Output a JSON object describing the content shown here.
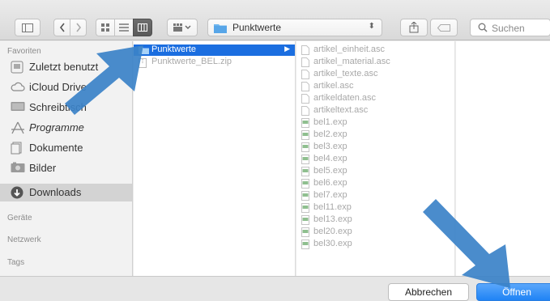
{
  "toolbar": {
    "sidebar_toggle_icon": "sidebar-toggle-icon",
    "back_icon": "chevron-left-icon",
    "forward_icon": "chevron-right-icon",
    "view_icons_icon": "icon-view-icon",
    "view_list_icon": "list-view-icon",
    "view_columns_icon": "column-view-icon",
    "view_gallery_icon": "gallery-view-icon",
    "path_label": "Punktwerte",
    "share_icon": "share-icon",
    "tag_icon": "tag-icon",
    "search_placeholder": "Suchen"
  },
  "sidebar": {
    "favorites_header": "Favoriten",
    "items": [
      {
        "label": "Zuletzt benutzt",
        "icon": "recents-icon"
      },
      {
        "label": "iCloud Drive",
        "icon": "cloud-icon"
      },
      {
        "label": "Schreibtisch",
        "icon": "desktop-icon"
      },
      {
        "label": "Programme",
        "icon": "applications-icon"
      },
      {
        "label": "Dokumente",
        "icon": "documents-icon"
      },
      {
        "label": "Bilder",
        "icon": "pictures-icon"
      },
      {
        "label": "Downloads",
        "icon": "downloads-icon"
      }
    ],
    "devices_header": "Geräte",
    "network_header": "Netzwerk",
    "tags_header": "Tags"
  },
  "column1": [
    {
      "label": "Punktwerte",
      "icon": "folder-icon",
      "selected": true
    },
    {
      "label": "Punktwerte_BEL.zip",
      "icon": "zip-file-icon",
      "selected": false
    }
  ],
  "column2": [
    {
      "label": "artikel_einheit.asc",
      "icon": "document-icon"
    },
    {
      "label": "artikel_material.asc",
      "icon": "document-icon"
    },
    {
      "label": "artikel_texte.asc",
      "icon": "document-icon"
    },
    {
      "label": "artikel.asc",
      "icon": "document-icon"
    },
    {
      "label": "artikeldaten.asc",
      "icon": "document-icon"
    },
    {
      "label": "artikeltext.asc",
      "icon": "document-icon"
    },
    {
      "label": "bel1.exp",
      "icon": "exp-file-icon"
    },
    {
      "label": "bel2.exp",
      "icon": "exp-file-icon"
    },
    {
      "label": "bel3.exp",
      "icon": "exp-file-icon"
    },
    {
      "label": "bel4.exp",
      "icon": "exp-file-icon"
    },
    {
      "label": "bel5.exp",
      "icon": "exp-file-icon"
    },
    {
      "label": "bel6.exp",
      "icon": "exp-file-icon"
    },
    {
      "label": "bel7.exp",
      "icon": "exp-file-icon"
    },
    {
      "label": "bel11.exp",
      "icon": "exp-file-icon"
    },
    {
      "label": "bel13.exp",
      "icon": "exp-file-icon"
    },
    {
      "label": "bel20.exp",
      "icon": "exp-file-icon"
    },
    {
      "label": "bel30.exp",
      "icon": "exp-file-icon"
    }
  ],
  "buttons": {
    "cancel": "Abbrechen",
    "open": "Öffnen"
  },
  "colors": {
    "accent": "#1b6ee0",
    "annotation_arrow": "#3b82c8"
  }
}
